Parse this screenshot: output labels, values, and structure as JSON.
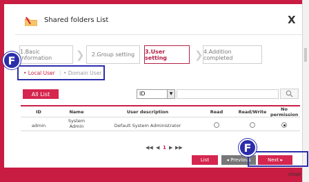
{
  "dialog": {
    "title": "Shared folders List",
    "close_label": "X"
  },
  "steps": [
    {
      "label": "1.Basic information",
      "active": false
    },
    {
      "label": "2.Group setting",
      "active": false
    },
    {
      "label": "3.User setting",
      "active": true
    },
    {
      "label": "4.Addition completed",
      "active": false
    }
  ],
  "tabs": {
    "local": "• Local User",
    "separator": "|",
    "domain": "• Domain User"
  },
  "annotations": {
    "tab_marker": "F",
    "next_marker": "F"
  },
  "toolbar": {
    "all_list_label": "All List",
    "search_field_selected": "ID",
    "search_value": ""
  },
  "table": {
    "headers": [
      "ID",
      "Name",
      "User description",
      "Read",
      "Read/Write",
      "No permission"
    ],
    "rows": [
      {
        "id": "admin",
        "name": "System Admin",
        "description": "Default System Administrator",
        "permission": "No permission"
      }
    ]
  },
  "pager": {
    "first": "◀◀",
    "prev": "◀",
    "current": "1",
    "next": "▶",
    "last": "▶▶"
  },
  "buttons": {
    "list": "List",
    "previous": "◂ Previous",
    "next": "Next ▸"
  },
  "footer": {
    "close_hint": "close"
  },
  "colors": {
    "accent": "#c81c42",
    "button_red": "#d5264f",
    "button_gray": "#777777",
    "annotation_blue": "#2b2dab"
  }
}
